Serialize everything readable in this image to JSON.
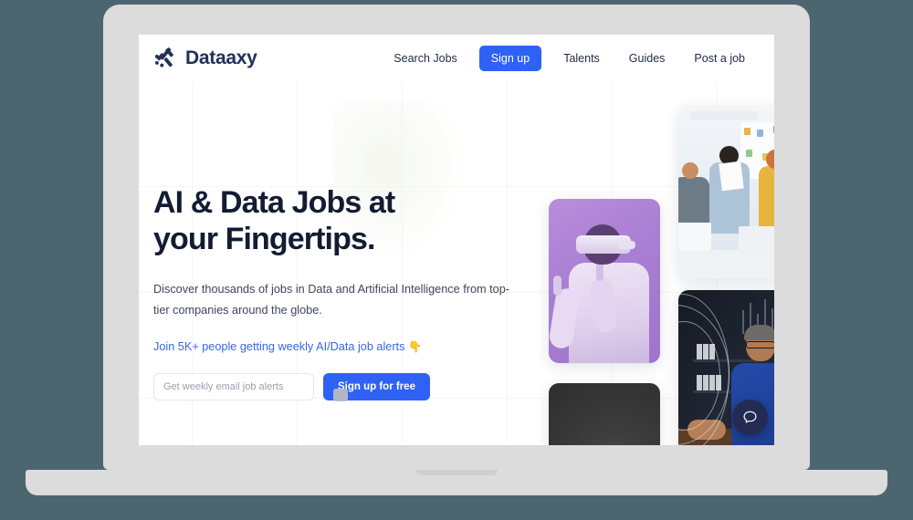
{
  "scene": {
    "background_color": "#4c6670",
    "device": "laptop-mockup",
    "device_body_color": "#dcdcdc"
  },
  "site": {
    "brand_name": "Dataaxy",
    "brand_color": "#22305a",
    "accent_color": "#2f62f4",
    "logo_icon": "dataaxy-slash-mark-icon"
  },
  "nav": {
    "links": [
      {
        "label": "Search Jobs",
        "name": "nav-link-search-jobs"
      },
      {
        "label": "Talents",
        "name": "nav-link-talents"
      },
      {
        "label": "Guides",
        "name": "nav-link-guides"
      },
      {
        "label": "Post a job",
        "name": "nav-link-post-a-job"
      }
    ],
    "signup_label": "Sign up"
  },
  "hero": {
    "title_line1": "AI & Data Jobs at your",
    "title_line2": "Fingertips.",
    "title_full": "AI & Data Jobs at your Fingertips.",
    "subtitle": "Discover thousands of jobs in Data and Artificial Intelligence from top-tier companies around the globe.",
    "link_text": "Join 5K+ people getting weekly AI/Data job alerts",
    "link_emoji": "👇",
    "form": {
      "email_placeholder": "Get weekly email job alerts",
      "email_value": "",
      "submit_label": "Sign up for free"
    }
  },
  "photos": [
    {
      "name": "photo-card-vr-headset",
      "alt": "Person wearing VR headset on purple background"
    },
    {
      "name": "photo-card-office-team",
      "alt": "Team collaborating in a bright office"
    },
    {
      "name": "photo-card-data-analyst",
      "alt": "Man with glasses working at a computer with data visuals"
    },
    {
      "name": "photo-card-dark-portrait",
      "alt": "Dark portrait photo partially cropped"
    }
  ],
  "chat": {
    "icon": "chat-bubble-icon",
    "color": "#232b52"
  }
}
